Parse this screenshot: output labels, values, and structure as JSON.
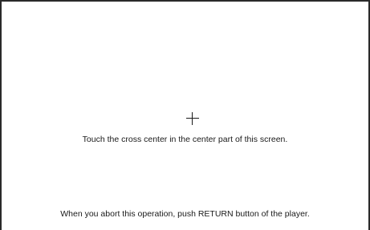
{
  "calibration": {
    "instruction": "Touch the cross center in the center part of this screen.",
    "abort_notice": "When you abort this operation, push RETURN button of the player.",
    "target_icon": "crosshair-icon"
  },
  "colors": {
    "background": "#ffffff",
    "text": "#1a1a1a",
    "border": "#2a2a2a"
  }
}
